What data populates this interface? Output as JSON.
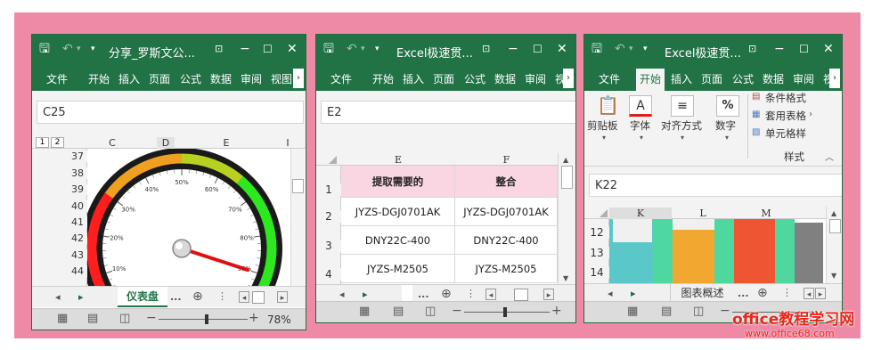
{
  "win1": {
    "title": "分享_罗斯文公...",
    "tabs": [
      "文件",
      "开始",
      "插入",
      "页面",
      "公式",
      "数据",
      "审阅",
      "视图"
    ],
    "name_box": "C25",
    "outline_levels": [
      "1",
      "2"
    ],
    "columns": [
      "C",
      "D",
      "E",
      "I"
    ],
    "rows": [
      "37",
      "38",
      "39",
      "40",
      "41",
      "42",
      "43",
      "44"
    ],
    "gauge_labels": [
      "10%",
      "20%",
      "30%",
      "40%",
      "50%",
      "60%",
      "70%",
      "80%",
      "90%"
    ],
    "gauge_value": 0.9,
    "sheet_tab": "仪表盘",
    "more": "...",
    "zoom": "78%"
  },
  "win2": {
    "title": "Excel极速贯...",
    "tabs": [
      "文件",
      "开始",
      "插入",
      "页面",
      "公式",
      "数据",
      "审阅",
      "视"
    ],
    "name_box": "E2",
    "columns": [
      "E",
      "F"
    ],
    "rows": [
      "1",
      "2",
      "3",
      "4"
    ],
    "table": [
      [
        "提取需要的",
        "整合"
      ],
      [
        "JYZS-DGJ0701AK",
        "JYZS-DGJ0701AK"
      ],
      [
        "DNY22C-400",
        "DNY22C-400"
      ],
      [
        "JYZS-M2505",
        "JYZS-M2505"
      ]
    ],
    "more": "..."
  },
  "win3": {
    "title": "Excel极速贯...",
    "tabs": [
      "文件",
      "开始",
      "插入",
      "页面",
      "公式",
      "数据",
      "审阅",
      "视"
    ],
    "groups": [
      "剪贴板",
      "字体",
      "对齐方式",
      "数字"
    ],
    "style_items": [
      "条件格式",
      "套用表格",
      "单元格样"
    ],
    "style_group": "样式",
    "name_box": "K22",
    "columns": [
      "K",
      "L",
      "M"
    ],
    "rows": [
      "12",
      "13",
      "14"
    ],
    "sheet_tab": "图表概述",
    "more": "..."
  },
  "watermark": {
    "brand": "office教程学习网",
    "url": "www.office68.com"
  },
  "colors": {
    "excel_green": "#217346",
    "pink_bg": "#ef8aa6",
    "header_fill": "#f9d6e2"
  }
}
